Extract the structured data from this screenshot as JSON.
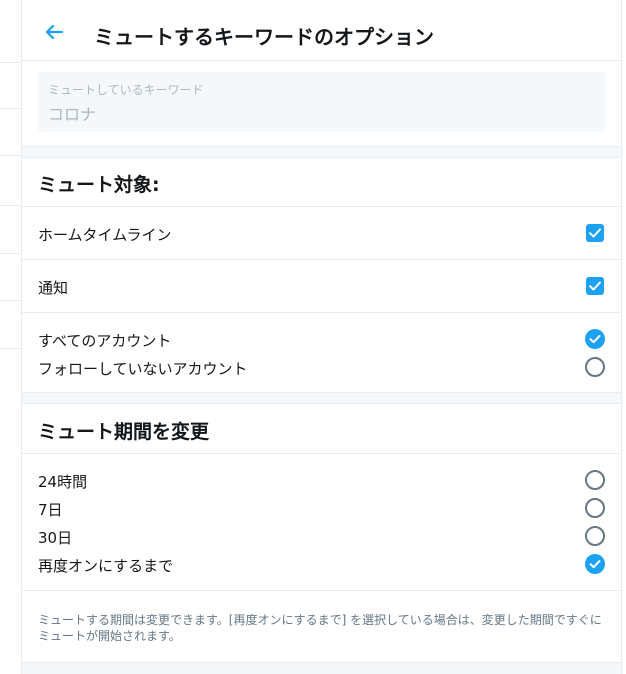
{
  "header": {
    "title": "ミュートするキーワードのオプション",
    "back_icon": "arrow-left-icon",
    "accent": "#1da1f2"
  },
  "keyword_field": {
    "label": "ミュートしているキーワード",
    "value": "コロナ"
  },
  "mute_from": {
    "title": "ミュート対象:",
    "options": [
      {
        "label": "ホームタイムライン",
        "checked": true
      },
      {
        "label": "通知",
        "checked": true
      }
    ],
    "accounts": [
      {
        "label": "すべてのアカウント",
        "selected": true
      },
      {
        "label": "フォローしていないアカウント",
        "selected": false
      }
    ]
  },
  "duration": {
    "title": "ミュート期間を変更",
    "options": [
      {
        "label": "24時間",
        "selected": false
      },
      {
        "label": "7日",
        "selected": false
      },
      {
        "label": "30日",
        "selected": false
      },
      {
        "label": "再度オンにするまで",
        "selected": true
      }
    ],
    "note": "ミュートする期間は変更できます。[再度オンにするまで] を選択している場合は、変更した期間ですぐにミュートが開始されます。"
  },
  "colors": {
    "accent": "#1da1f2",
    "border": "#e6ecf0",
    "muted_text": "#657786"
  }
}
